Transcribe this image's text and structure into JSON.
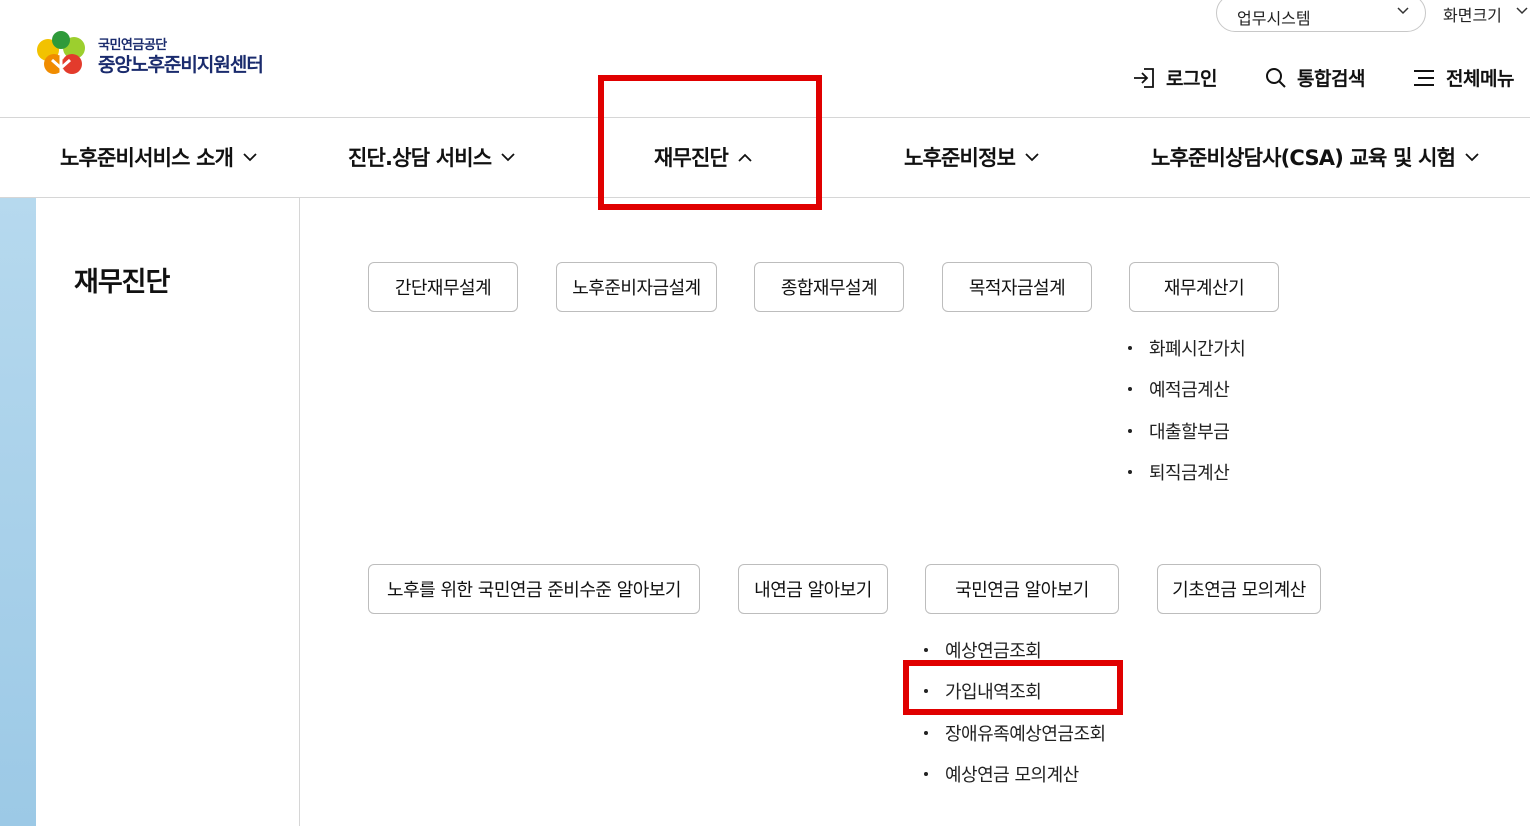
{
  "logo": {
    "org": "국민연금공단",
    "center": "중앙노후준비지원센터"
  },
  "top_util": {
    "system_select": "업무시스템",
    "screen_size": "화면크기",
    "login": "로그인",
    "search": "통합검색",
    "menu": "전체메뉴"
  },
  "gnb": [
    {
      "label": "노후준비서비스 소개"
    },
    {
      "label": "진단.상담 서비스"
    },
    {
      "label": "재무진단"
    },
    {
      "label": "노후준비정보"
    },
    {
      "label": "노후준비상담사(CSA) 교육 및 시험"
    }
  ],
  "sidebar": {
    "title": "재무진단"
  },
  "row1_buttons": [
    "간단재무설계",
    "노후준비자금설계",
    "종합재무설계",
    "목적자금설계",
    "재무계산기"
  ],
  "calculator_sub": [
    "화폐시간가치",
    "예적금계산",
    "대출할부금",
    "퇴직금계산"
  ],
  "row2_buttons": [
    "노후를 위한 국민연금 준비수준 알아보기",
    "내연금 알아보기",
    "국민연금 알아보기",
    "기초연금 모의계산"
  ],
  "pension_sub": [
    "예상연금조회",
    "가입내역조회",
    "장애유족예상연금조회",
    "예상연금 모의계산"
  ],
  "colors": {
    "highlight": "#e00000",
    "brand_navy": "#1a2b6d",
    "rail": "#a9d2ec"
  }
}
